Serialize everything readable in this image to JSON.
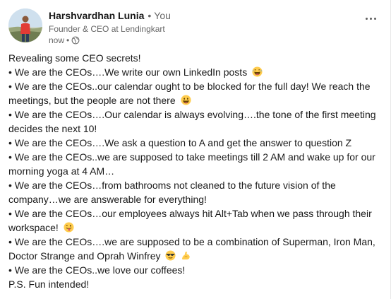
{
  "author": {
    "name": "Harshvardhan Lunia",
    "connection": "You",
    "headline": "Founder & CEO at Lendingkart",
    "time": "now",
    "visibility_icon": "globe-icon"
  },
  "menu_icon": "more-horizontal-icon",
  "post": {
    "lines": [
      {
        "text": "Revealing some CEO secrets!",
        "emoji": ""
      },
      {
        "text": "• We are the CEOs….We write our own LinkedIn posts",
        "emoji": "laughing-face-emoji"
      },
      {
        "text": "• We are the CEOs..our calendar ought to be blocked for the full day! We reach the meetings, but the people are not there",
        "emoji": "grinning-face-emoji"
      },
      {
        "text": "• We are the CEOs….Our calendar is always evolving….the tone of the first meeting decides the next 10!",
        "emoji": ""
      },
      {
        "text": "• We are the CEOs….We ask a question to A and get the answer to question Z",
        "emoji": ""
      },
      {
        "text": "• We are the CEOs..we are supposed to take meetings till 2 AM and wake up for our morning yoga at 4 AM…",
        "emoji": ""
      },
      {
        "text": "• We are the CEOs…from bathrooms not cleaned to the future vision of the company…we are answerable for everything!",
        "emoji": ""
      },
      {
        "text": "• We are the CEOs…our employees always hit Alt+Tab when we pass through their workspace!",
        "emoji": "tongue-out-face-emoji"
      },
      {
        "text": "• We are the CEOs….we are supposed to be a combination of Superman, Iron Man, Doctor Strange and Oprah Winfrey",
        "emoji": "sunglasses-face-emoji",
        "emoji2": "flexed-biceps-emoji"
      },
      {
        "text": "• We are the CEOs..we love our coffees!",
        "emoji": ""
      },
      {
        "text": "P.S. Fun intended!",
        "emoji": ""
      }
    ]
  },
  "colors": {
    "text": "#191919",
    "muted": "#666666",
    "emoji_yellow": "#FFCC4D"
  }
}
